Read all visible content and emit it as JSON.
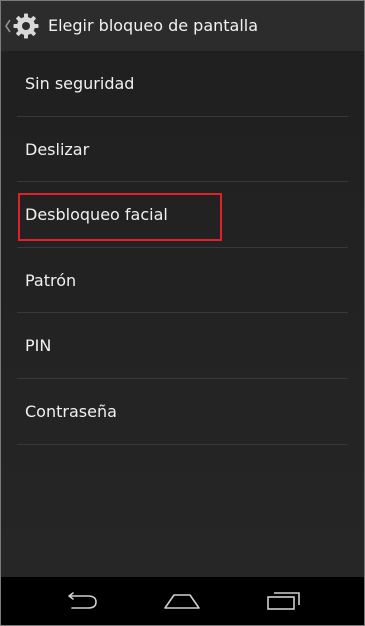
{
  "header": {
    "title": "Elegir bloqueo de pantalla",
    "up_icon": "chevron-left-icon",
    "app_icon": "gear-icon"
  },
  "options": [
    {
      "label": "Sin seguridad"
    },
    {
      "label": "Deslizar"
    },
    {
      "label": "Desbloqueo facial"
    },
    {
      "label": "Patrón"
    },
    {
      "label": "PIN"
    },
    {
      "label": "Contraseña"
    }
  ],
  "highlighted_option": "Desbloqueo facial",
  "navigation": {
    "back_icon": "back-icon",
    "home_icon": "home-icon",
    "recents_icon": "recents-icon"
  },
  "colors": {
    "background": "#1f1f1f",
    "action_bar": "#2c2c2c",
    "text": "#f0f0f0",
    "divider": "#383838",
    "highlight": "#e0202b",
    "nav_bar": "#000000"
  }
}
